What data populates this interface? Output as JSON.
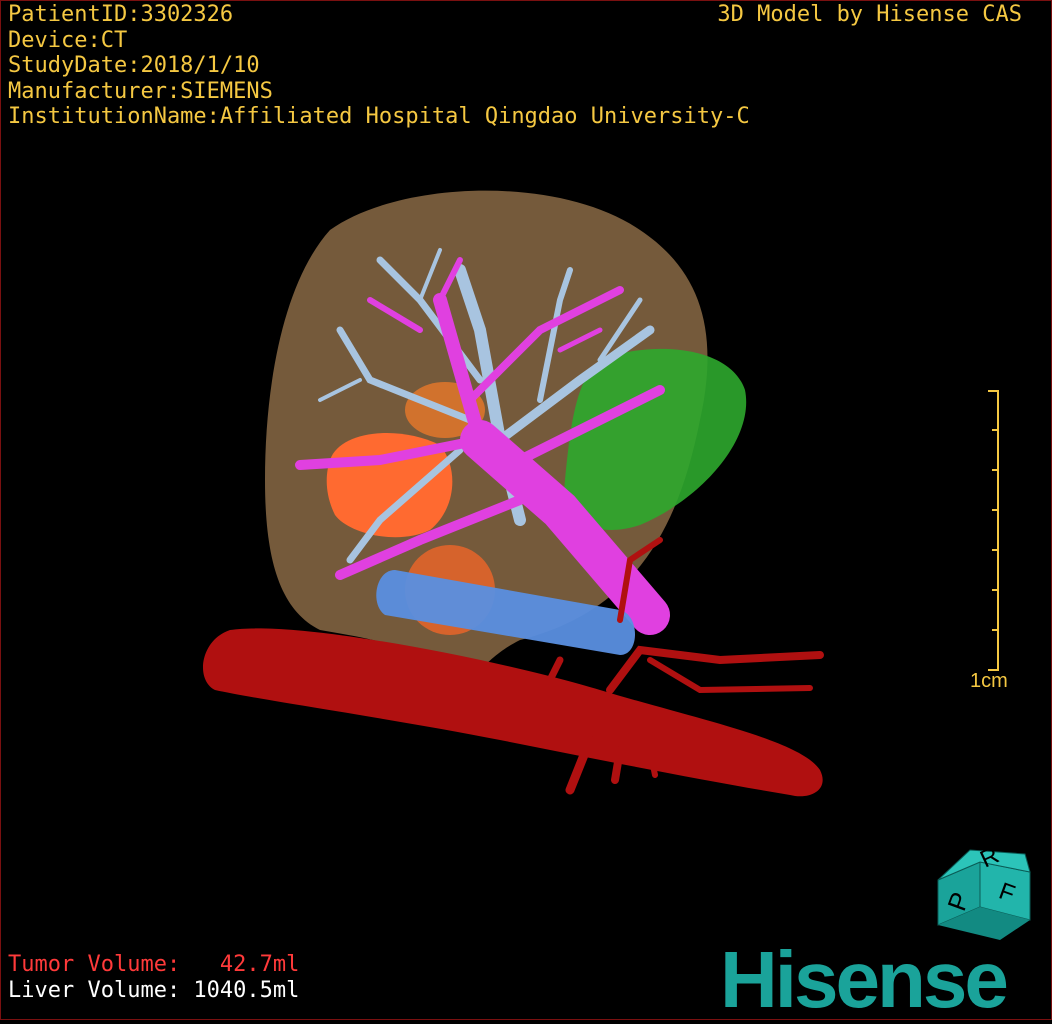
{
  "patient": {
    "patient_id": "PatientID:3302326",
    "device": "Device:CT",
    "study_date": "StudyDate:2018/1/10",
    "manufacturer": "Manufacturer:SIEMENS",
    "institution": "InstitutionName:Affiliated Hospital Qingdao University-C"
  },
  "header": {
    "model_credit": "3D Model by Hisense CAS"
  },
  "volumes": {
    "tumor": "Tumor Volume:   42.7ml",
    "liver": "Liver Volume: 1040.5ml"
  },
  "scale": {
    "label": "1cm"
  },
  "orientation_cube": {
    "faces": [
      "R",
      "P",
      "F"
    ]
  },
  "logo": {
    "text": "Hisense"
  },
  "colors": {
    "text_info": "#f5c842",
    "tumor_text": "#ff3a3a",
    "liver": "#8a6a45",
    "portal_vein": "#e040e0",
    "hepatic_vein": "#a8c4e0",
    "tumor": "#ff6a30",
    "gallbladder": "#2ea82e",
    "artery": "#b01010",
    "ivc": "#5a8fe0",
    "logo": "#1aa39a"
  }
}
